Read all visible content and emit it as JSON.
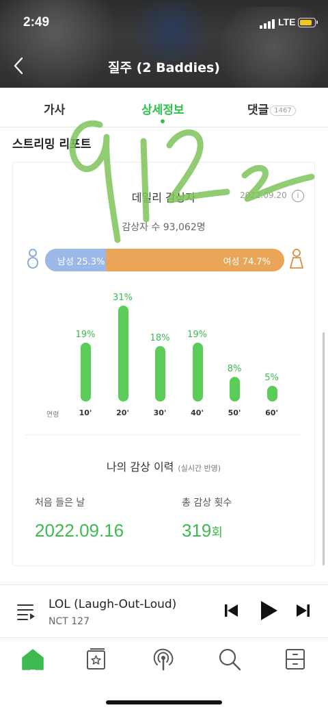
{
  "status_bar": {
    "time": "2:49",
    "network": "LTE"
  },
  "nav": {
    "title": "질주 (2 Baddies)"
  },
  "tabs": [
    {
      "label": "가사"
    },
    {
      "label": "상세정보",
      "active": true
    },
    {
      "label": "댓글",
      "count": "1467"
    }
  ],
  "section_title": "스트리밍 리포트",
  "report": {
    "title": "데일리 감상자",
    "date": "2022.09.20",
    "listeners": "감상자 수 93,062명",
    "gender": {
      "male_label": "남성 25.3%",
      "female_label": "여성 74.7%",
      "male_fraction": 0.253,
      "male_color": "#9bb8e8",
      "female_color": "#eba558"
    },
    "age_axis_label": "연령"
  },
  "chart_data": {
    "type": "bar",
    "categories": [
      "10'",
      "20'",
      "30'",
      "40'",
      "50'",
      "60'"
    ],
    "values": [
      19,
      31,
      18,
      19,
      8,
      5
    ],
    "value_labels": [
      "19%",
      "31%",
      "18%",
      "19%",
      "8%",
      "5%"
    ],
    "xlabel": "연령",
    "ylabel": "",
    "ylim": [
      0,
      31
    ],
    "bar_color": "#5ccc58"
  },
  "history": {
    "title": "나의 감상 이력",
    "subtitle": "(실시간 반영)",
    "first_listen_label": "처음 들은 날",
    "first_listen_value": "2022.09.16",
    "total_label": "총 감상 횟수",
    "total_value": "319",
    "total_unit": "회"
  },
  "player": {
    "song": "LOL (Laugh-Out-Loud)",
    "artist": "NCT 127"
  },
  "handwriting": "9122",
  "colors": {
    "accent": "#2ec24a",
    "header_bg": "#2f2f2f"
  }
}
